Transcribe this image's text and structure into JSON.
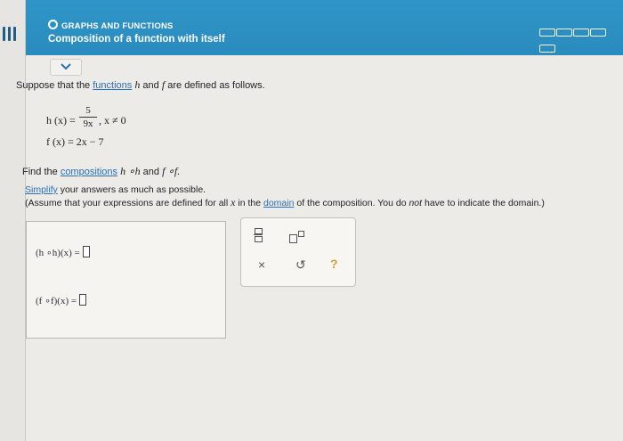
{
  "header": {
    "topic": "GRAPHS AND FUNCTIONS",
    "title": "Composition of a function with itself",
    "progress_segments": 5,
    "bg_color": "#2f95c8"
  },
  "question": {
    "intro_prefix": "Suppose that the",
    "intro_link": "functions",
    "intro_mid_h": "h",
    "intro_and": "and",
    "intro_f": "f",
    "intro_suffix": "are defined as follows.",
    "h_lhs": "h (x) =",
    "h_num": "5",
    "h_den": "9x",
    "h_cond": ", x ≠ 0",
    "f_def": "f (x) = 2x − 7",
    "find_prefix": "Find the",
    "find_link": "compositions",
    "find_hh": "h ∘h",
    "find_and": "and",
    "find_ff": "f ∘f.",
    "simplify_link": "Simplify",
    "simplify_rest": "your answers as much as possible.",
    "assume_prefix": "(Assume that your expressions are defined for all",
    "assume_x": "x",
    "assume_in": "in the",
    "assume_domain": "domain",
    "assume_of": "of the composition. You do",
    "assume_not": "not",
    "assume_suffix": "have to indicate the domain.)"
  },
  "answers": {
    "hh_label": "(h ∘h)(x) =",
    "ff_label": "(f ∘f)(x) ="
  },
  "toolbox": {
    "clear_symbol": "×",
    "undo_symbol": "↺",
    "help_symbol": "?"
  }
}
